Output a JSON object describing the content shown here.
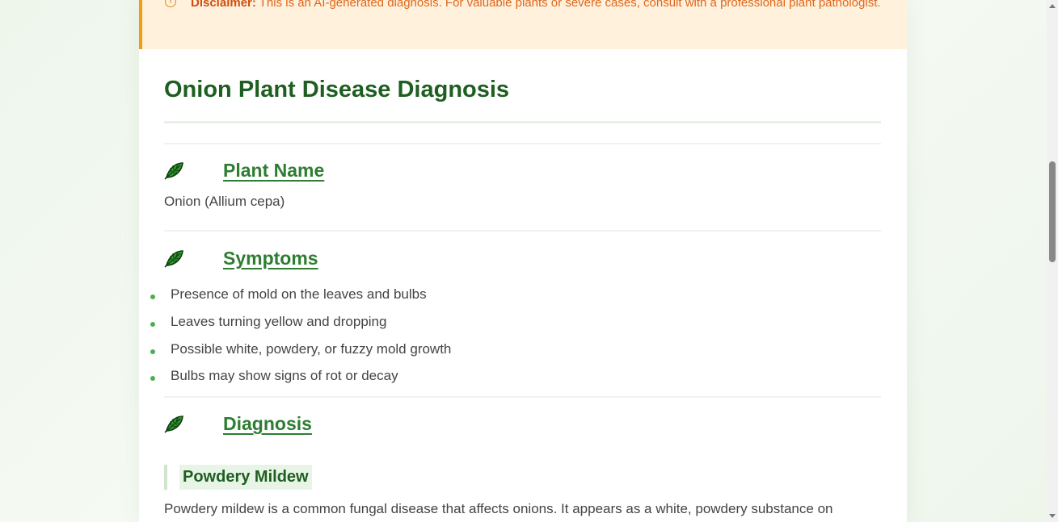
{
  "disclaimer": {
    "label": "Disclaimer:",
    "text": " This is an AI-generated diagnosis. For valuable plants or severe cases, consult with a professional plant pathologist.",
    "icon": "alert-circle-icon"
  },
  "report": {
    "title": "Onion Plant Disease Diagnosis",
    "sections": [
      {
        "heading": "Plant Name",
        "icon": "leaf-icon",
        "value": "Onion (Allium cepa)"
      },
      {
        "heading": "Symptoms",
        "icon": "leaf-icon",
        "items": [
          "Presence of mold on the leaves and bulbs",
          "Leaves turning yellow and dropping",
          "Possible white, powdery, or fuzzy mold growth",
          "Bulbs may show signs of rot or decay"
        ]
      },
      {
        "heading": "Diagnosis",
        "icon": "leaf-icon",
        "subheading": "Powdery Mildew",
        "paragraph": "Powdery mildew is a common fungal disease that affects onions. It appears as a white, powdery substance on"
      }
    ]
  },
  "colors": {
    "accent_green": "#2e7d32",
    "title_green": "#1e5e20",
    "disclaimer_bg": "#fff1dc",
    "disclaimer_border": "#f39c12",
    "disclaimer_text": "#e0661a"
  }
}
